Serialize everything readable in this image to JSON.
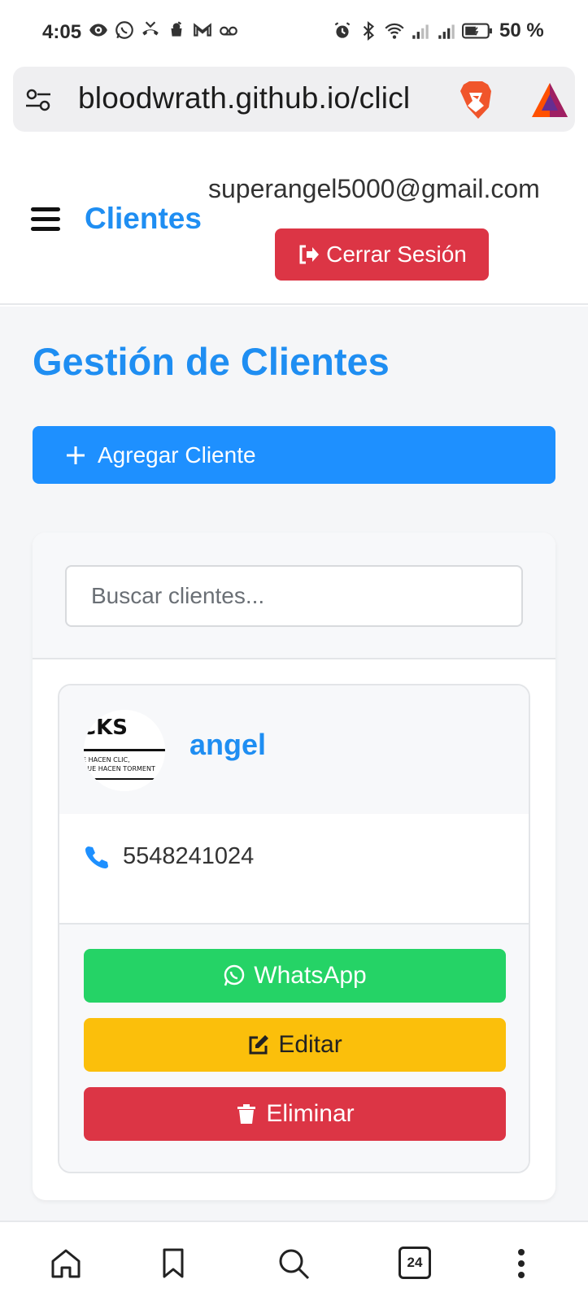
{
  "status_bar": {
    "time": "4:05",
    "battery_percent": "50 %",
    "left_icons": [
      "eye-icon",
      "whatsapp-icon",
      "missed-call-icon",
      "cloud-icon",
      "gmail-icon",
      "voicemail-icon"
    ],
    "right_icons": [
      "alarm-icon",
      "bluetooth-icon",
      "wifi-icon",
      "signal-icon",
      "signal-icon",
      "battery-icon"
    ]
  },
  "browser": {
    "url": "bloodwrath.github.io/clicl",
    "tab_count": "24",
    "icons": [
      "tune-icon",
      "brave-lion-icon",
      "bat-triangle-icon"
    ]
  },
  "header": {
    "brand": "Clientes",
    "user_email": "superangel5000@gmail.com",
    "logout_label": "Cerrar Sesión"
  },
  "main": {
    "title": "Gestión de Clientes",
    "add_label": "Agregar Cliente",
    "search_placeholder": "Buscar clientes..."
  },
  "clients": [
    {
      "name": "angel",
      "phone": "5548241024",
      "avatar_text": [
        "CKS",
        "E HACEN CLIC,",
        "QUE HACEN TORMENT"
      ],
      "actions": {
        "whatsapp": "WhatsApp",
        "edit": "Editar",
        "delete": "Eliminar"
      }
    }
  ],
  "colors": {
    "primary": "#1e90ff",
    "title_blue": "#1f8ef2",
    "danger": "#dc3545",
    "whatsapp": "#25d366",
    "warning": "#fbbf0b",
    "page_bg": "#f5f6f8"
  },
  "bottom_nav": {
    "items": [
      "home-icon",
      "bookmark-icon",
      "search-icon",
      "tabs-icon",
      "more-vertical-icon"
    ]
  }
}
